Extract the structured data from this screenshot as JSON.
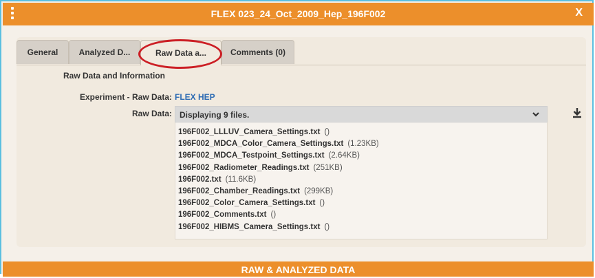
{
  "window": {
    "title": "FLEX 023_24_Oct_2009_Hep_196F002",
    "close_label": "X"
  },
  "tabs": [
    {
      "label": "General"
    },
    {
      "label": "Analyzed D..."
    },
    {
      "label": "Raw Data a..."
    },
    {
      "label": "Comments (0)"
    }
  ],
  "active_tab": "Raw Data a...",
  "section": {
    "title": "Raw Data and Information"
  },
  "experiment": {
    "label": "Experiment - Raw Data:",
    "value": "FLEX HEP"
  },
  "raw_data": {
    "label": "Raw Data:",
    "selected": "Displaying 9 files."
  },
  "files": [
    {
      "name": "196F002_LLLUV_Camera_Settings.txt",
      "size": "()"
    },
    {
      "name": "196F002_MDCA_Color_Camera_Settings.txt",
      "size": "(1.23KB)"
    },
    {
      "name": "196F002_MDCA_Testpoint_Settings.txt",
      "size": "(2.64KB)"
    },
    {
      "name": "196F002_Radiometer_Readings.txt",
      "size": "(251KB)"
    },
    {
      "name": "196F002.txt",
      "size": "(11.6KB)"
    },
    {
      "name": "196F002_Chamber_Readings.txt",
      "size": "(299KB)"
    },
    {
      "name": "196F002_Color_Camera_Settings.txt",
      "size": "()"
    },
    {
      "name": "196F002_Comments.txt",
      "size": "()"
    },
    {
      "name": "196F002_HIBMS_Camera_Settings.txt",
      "size": "()"
    }
  ],
  "footer": {
    "label": "RAW & ANALYZED DATA"
  },
  "colors": {
    "accent": "#ec8f2b",
    "link": "#2d6bb3",
    "highlight_circle": "#cc1f25",
    "frame_border": "#5bbfe0"
  }
}
